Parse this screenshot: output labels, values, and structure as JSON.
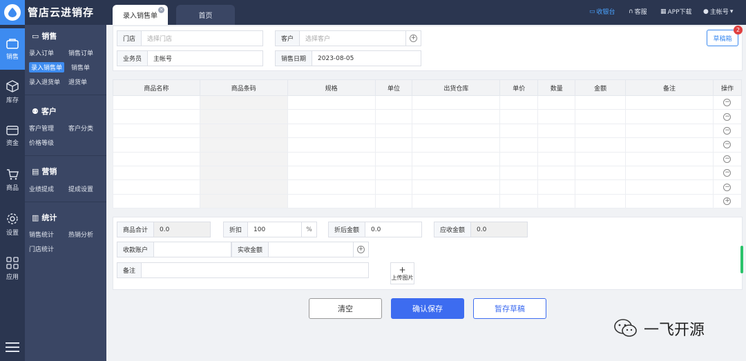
{
  "app": {
    "title": "管店云进销存"
  },
  "tabs": {
    "active": "录入销售单",
    "home": "首页"
  },
  "topRight": {
    "cashier": "收银台",
    "service": "客服",
    "app_download": "APP下载",
    "account": "主帐号"
  },
  "iconbar": [
    {
      "label": "销售",
      "icon": "sales-icon"
    },
    {
      "label": "库存",
      "icon": "inventory-icon"
    },
    {
      "label": "资金",
      "icon": "wallet-icon"
    },
    {
      "label": "商品",
      "icon": "cart-icon"
    },
    {
      "label": "设置",
      "icon": "gear-icon"
    },
    {
      "label": "应用",
      "icon": "apps-icon"
    }
  ],
  "sidebar": {
    "sales": {
      "title": "销售",
      "items": [
        "录入订单",
        "销售订单",
        "录入销售单",
        "销售单",
        "录入退货单",
        "退货单"
      ]
    },
    "customer": {
      "title": "客户",
      "items": [
        "客户管理",
        "客户分类",
        "价格等级"
      ]
    },
    "marketing": {
      "title": "营销",
      "items": [
        "业绩提成",
        "提成设置"
      ]
    },
    "stats": {
      "title": "统计",
      "items": [
        "销售统计",
        "热销分析",
        "门店统计"
      ]
    }
  },
  "form": {
    "store_label": "门店",
    "store_placeholder": "选择门店",
    "customer_label": "客户",
    "customer_placeholder": "选择客户",
    "salesman_label": "业务员",
    "salesman_value": "主帐号",
    "date_label": "销售日期",
    "date_value": "2023-08-05",
    "draft_box": "草稿箱",
    "draft_count": "2"
  },
  "table": {
    "columns": [
      "商品名称",
      "商品条码",
      "规格",
      "单位",
      "出货仓库",
      "单价",
      "数量",
      "金额",
      "备注",
      "操作"
    ],
    "row_count": 8
  },
  "summary": {
    "total_label": "商品合计",
    "total_value": "0.0",
    "discount_label": "折扣",
    "discount_value": "100",
    "discount_unit": "%",
    "after_label": "折后金额",
    "after_value": "0.0",
    "receivable_label": "应收金额",
    "receivable_value": "0.0",
    "account_label": "收款账户",
    "account_value": "",
    "received_label": "实收金额",
    "received_value": "",
    "note_label": "备注",
    "note_value": "",
    "upload_label": "上传图片"
  },
  "actions": {
    "clear": "清空",
    "save": "确认保存",
    "draft": "暂存草稿"
  },
  "watermark": {
    "text": "一飞开源"
  }
}
